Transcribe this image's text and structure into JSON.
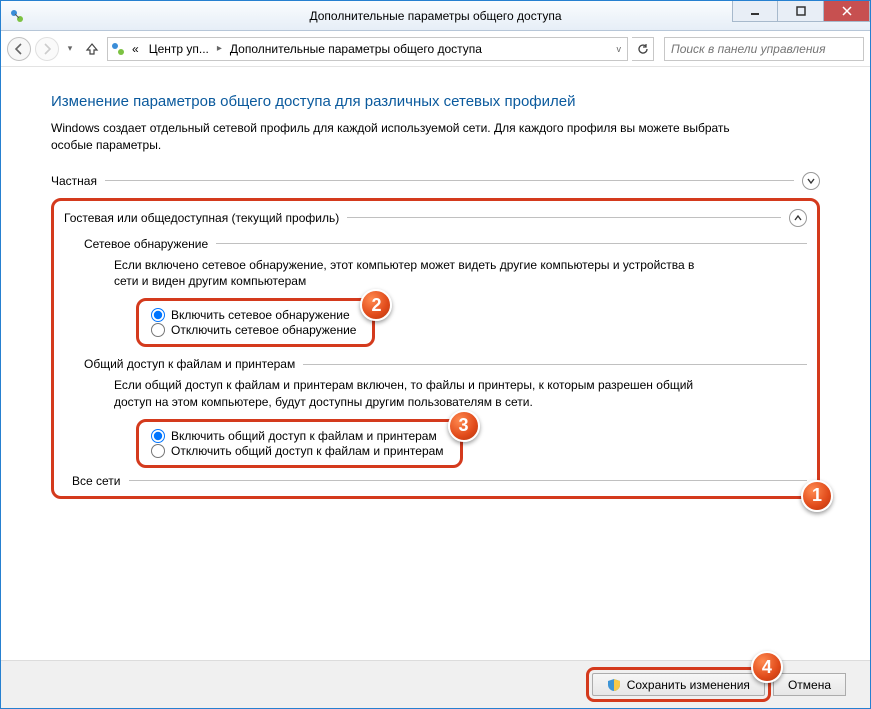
{
  "window": {
    "title": "Дополнительные параметры общего доступа"
  },
  "nav": {
    "breadcrumb_prefix": "«",
    "breadcrumb_item1": "Центр уп...",
    "breadcrumb_item2": "Дополнительные параметры общего доступа",
    "search_placeholder": "Поиск в панели управления"
  },
  "page": {
    "title": "Изменение параметров общего доступа для различных сетевых профилей",
    "desc": "Windows создает отдельный сетевой профиль для каждой используемой сети. Для каждого профиля вы можете выбрать особые параметры."
  },
  "profiles": {
    "private_label": "Частная",
    "guest_label": "Гостевая или общедоступная (текущий профиль)",
    "allnets_label": "Все сети"
  },
  "discovery": {
    "heading": "Сетевое обнаружение",
    "desc": "Если включено сетевое обнаружение, этот компьютер может видеть другие компьютеры и устройства в сети и виден другим компьютерам",
    "opt_on": "Включить сетевое обнаружение",
    "opt_off": "Отключить сетевое обнаружение"
  },
  "fileshare": {
    "heading": "Общий доступ к файлам и принтерам",
    "desc": "Если общий доступ к файлам и принтерам включен, то файлы и принтеры, к которым разрешен общий доступ на этом компьютере, будут доступны другим пользователям в сети.",
    "opt_on": "Включить общий доступ к файлам и принтерам",
    "opt_off": "Отключить общий доступ к файлам и принтерам"
  },
  "footer": {
    "save": "Сохранить изменения",
    "cancel": "Отмена"
  },
  "badges": {
    "b1": "1",
    "b2": "2",
    "b3": "3",
    "b4": "4"
  }
}
